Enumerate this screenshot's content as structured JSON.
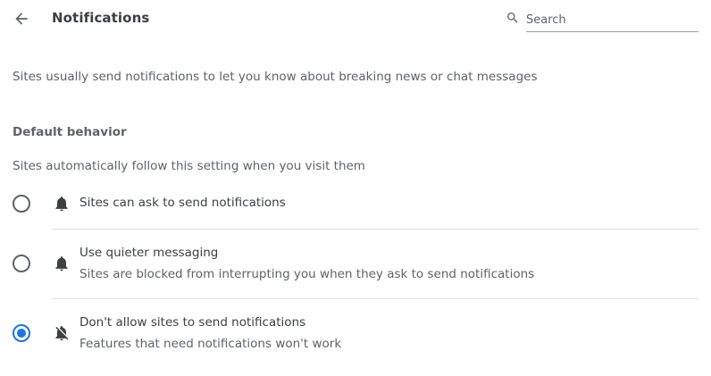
{
  "header": {
    "back_icon": "arrow-back-icon",
    "title": "Notifications",
    "search": {
      "placeholder": "Search",
      "value": "",
      "icon": "search-icon"
    }
  },
  "intro": "Sites usually send notifications to let you know about breaking news or chat messages",
  "default_behavior": {
    "title": "Default behavior",
    "description": "Sites automatically follow this setting when you visit them",
    "options": [
      {
        "label": "Sites can ask to send notifications",
        "sublabel": "",
        "icon": "bell-icon",
        "selected": false
      },
      {
        "label": "Use quieter messaging",
        "sublabel": "Sites are blocked from interrupting you when they ask to send notifications",
        "icon": "bell-icon",
        "selected": false
      },
      {
        "label": "Don't allow sites to send notifications",
        "sublabel": "Features that need notifications won't work",
        "icon": "bell-off-icon",
        "selected": true
      }
    ]
  },
  "colors": {
    "accent": "#1a73e8",
    "text_primary": "#3c4043",
    "text_secondary": "#5f6368",
    "divider": "#e0e0e0"
  }
}
